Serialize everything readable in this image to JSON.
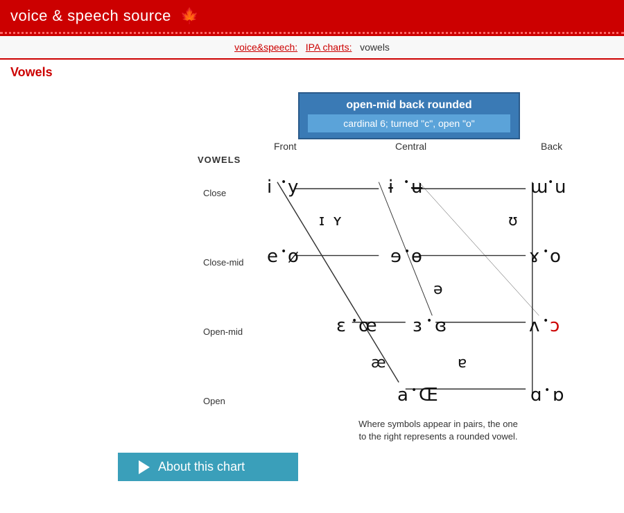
{
  "header": {
    "title": "voice & speech source",
    "maple_leaf": "✿"
  },
  "breadcrumb": {
    "voice_speech": "voice&speech:",
    "ipa_charts": "IPA charts:",
    "current": "vowels"
  },
  "page_title": "Vowels",
  "tooltip": {
    "main": "open-mid back rounded",
    "sub": "cardinal 6; turned \"c\", open \"o\""
  },
  "vowels_label": "VOWELS",
  "column_headers": {
    "front": "Front",
    "central": "Central",
    "back": "Back"
  },
  "row_labels": {
    "close": "Close",
    "close_mid": "Close-mid",
    "open_mid": "Open-mid",
    "open": "Open"
  },
  "pair_note": "Where symbols appear in pairs, the one\nto the right represents a rounded vowel.",
  "about_button": "About this chart"
}
